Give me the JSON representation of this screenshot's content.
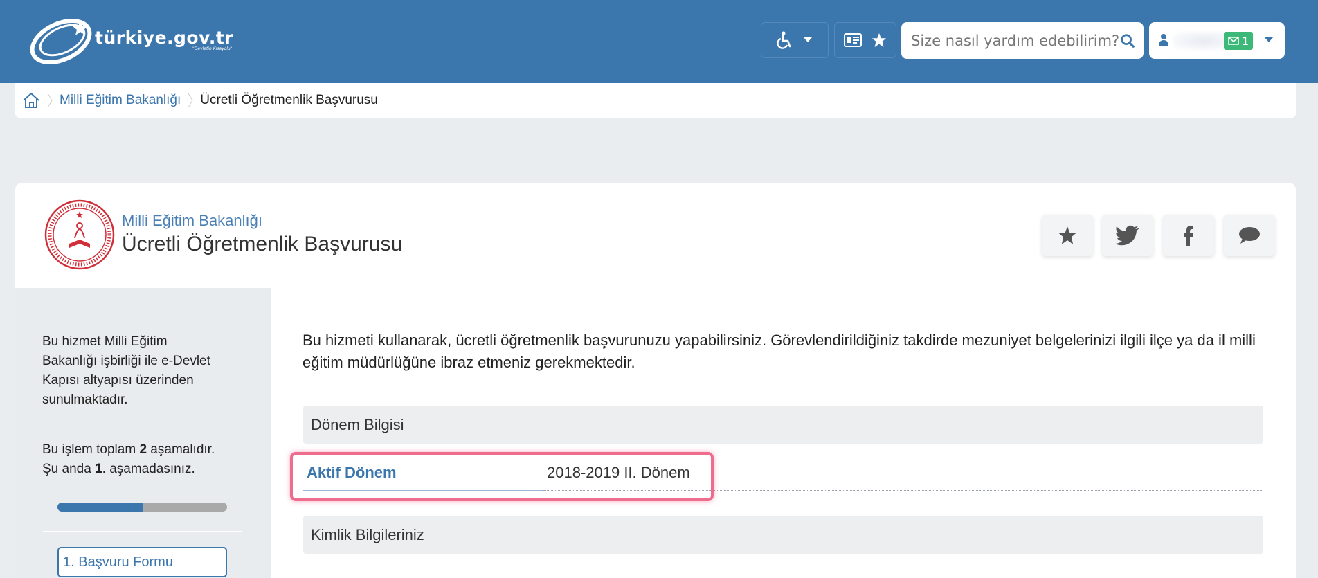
{
  "header": {
    "logo_text": "türkiye.gov.tr",
    "logo_tagline": "\"Devletin Kısayolu\"",
    "search_placeholder": "Size nasıl yardım edebilirim?",
    "message_count": "1",
    "icons": [
      "accessibility-icon",
      "caret-down-icon",
      "id-card-icon",
      "star-icon",
      "search-icon",
      "user-icon",
      "envelope-icon"
    ]
  },
  "breadcrumb": {
    "items": [
      "Milli Eğitim Bakanlığı",
      "Ücretli Öğretmenlik Başvurusu"
    ]
  },
  "service": {
    "agency": "Milli Eğitim Bakanlığı",
    "title": "Ücretli Öğretmenlik Başvurusu",
    "share_icons": [
      "star-icon",
      "twitter-icon",
      "facebook-icon",
      "comment-icon"
    ]
  },
  "sidebar": {
    "note": "Bu hizmet Milli Eğitim Bakanlığı işbirliği ile e-Devlet Kapısı altyapısı üzerinden sunulmaktadır.",
    "step_text_1": "Bu işlem toplam ",
    "step_total": "2",
    "step_text_2": " aşamalıdır. Şu anda ",
    "step_current": "1",
    "step_text_3": ". aşamadasınız.",
    "progress": 0.5,
    "step_button": "1. Başvuru Formu"
  },
  "content": {
    "intro": "Bu hizmeti kullanarak, ücretli öğretmenlik başvurunuzu yapabilirsiniz. Görevlendirildiğiniz takdirde mezuniyet belgelerinizi ilgili ilçe ya da il milli eğitim müdürlüğüne ibraz etmeniz gerekmektedir.",
    "section1": "Dönem Bilgisi",
    "field_label": "Aktif Dönem",
    "field_value": "2018-2019 II. Dönem",
    "section2": "Kimlik Bilgileriniz"
  },
  "colors": {
    "brand": "#3b76ac",
    "highlight": "#ee6c8e",
    "badge": "#3cb878"
  }
}
